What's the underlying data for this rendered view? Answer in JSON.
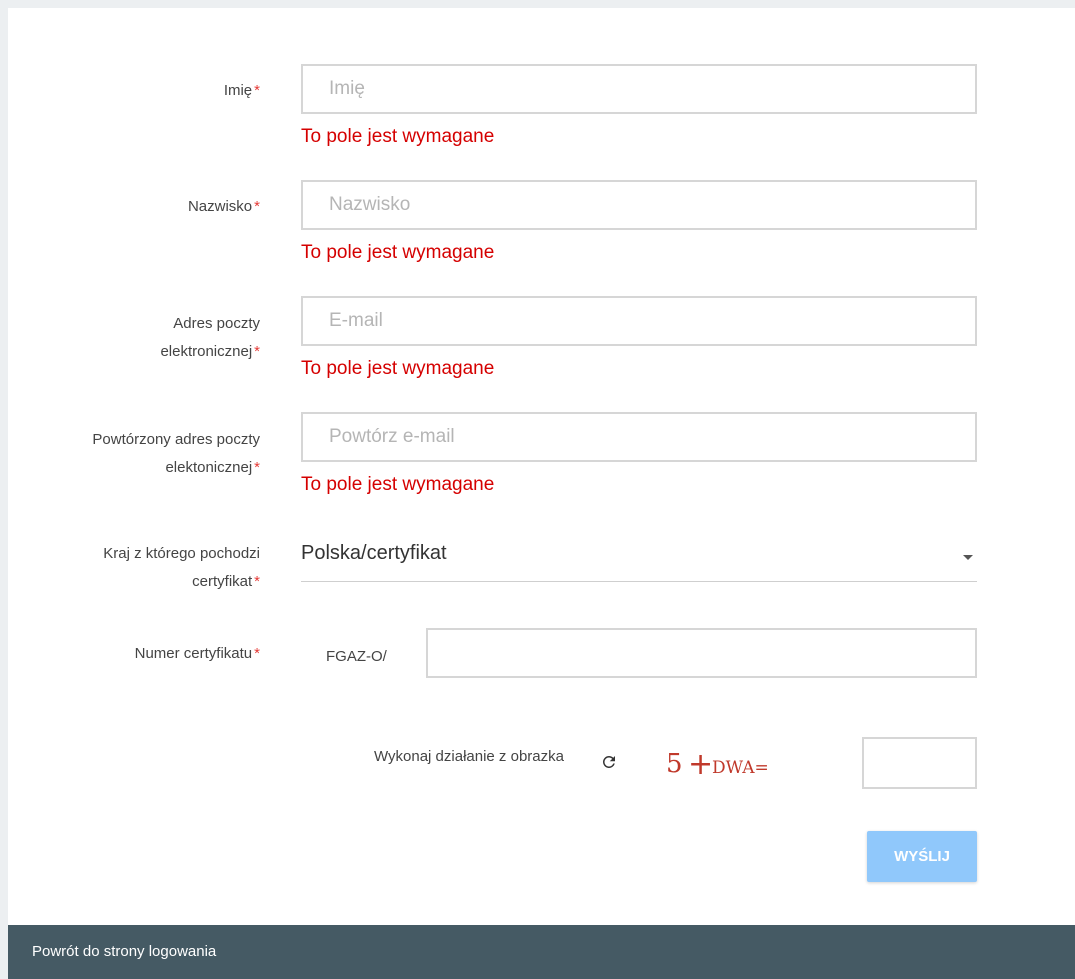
{
  "form": {
    "first_name": {
      "label": "Imię",
      "placeholder": "Imię",
      "error": "To pole jest wymagane"
    },
    "last_name": {
      "label": "Nazwisko",
      "placeholder": "Nazwisko",
      "error": "To pole jest wymagane"
    },
    "email": {
      "label_line1": "Adres poczty",
      "label_line2": "elektronicznej",
      "placeholder": "E-mail",
      "error": "To pole jest wymagane"
    },
    "email_repeat": {
      "label_line1": "Powtórzony adres poczty",
      "label_line2": "elektonicznej",
      "placeholder": "Powtórz e-mail",
      "error": "To pole jest wymagane"
    },
    "country": {
      "label_line1": "Kraj z którego pochodzi",
      "label_line2": "certyfikat",
      "value": "Polska/certyfikat"
    },
    "cert_number": {
      "label": "Numer certyfikatu",
      "prefix": "FGAZ-O/",
      "value": ""
    },
    "captcha": {
      "label": "Wykonaj działanie z obrazka",
      "image_text_digit": "5",
      "image_text_op": "+",
      "image_text_rest": "DWA="
    },
    "required_mark": "*",
    "submit_label": "WYŚLIJ"
  },
  "footer": {
    "back_link": "Powrót do strony logowania"
  },
  "colors": {
    "error": "#d50000",
    "required": "#e53935",
    "submit_bg": "#90c8fb",
    "footer_bg": "#455a64",
    "captcha_text": "#c0392b"
  },
  "icons": {
    "refresh": "refresh-icon",
    "dropdown": "caret-down-icon"
  }
}
